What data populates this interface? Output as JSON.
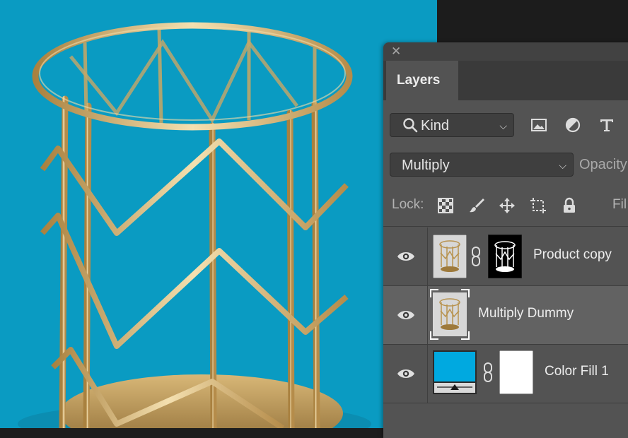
{
  "panel": {
    "close_glyph": "✕",
    "tab": "Layers",
    "filter": {
      "selected": "Kind",
      "icon": "search-icon"
    },
    "filter_icons": [
      "image-filter-icon",
      "adjustment-filter-icon",
      "type-filter-icon"
    ],
    "blend_mode": "Multiply",
    "opacity_label": "Opacity",
    "lock_label": "Lock:",
    "fill_label": "Fil",
    "lock_icons": [
      "lock-transparent-pixels-icon",
      "lock-image-pixels-icon",
      "lock-position-icon",
      "lock-artboard-icon",
      "lock-all-icon"
    ],
    "layers": [
      {
        "name": "Product copy",
        "visible": true,
        "has_mask": true,
        "selected": false
      },
      {
        "name": "Multiply Dummy",
        "visible": true,
        "has_mask": false,
        "selected": true
      },
      {
        "name": "Color Fill 1",
        "visible": true,
        "has_mask": true,
        "selected": false,
        "fill_color": "#00a9e0"
      }
    ]
  },
  "colors": {
    "canvas_background": "#0a9bc2",
    "panel": "#535353",
    "selected_row": "#626262"
  }
}
